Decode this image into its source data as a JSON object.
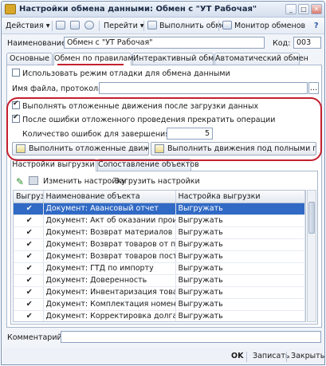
{
  "window": {
    "title": "Настройки обмена данными: Обмен с \"УТ Рабочая\"",
    "btn_min": "_",
    "btn_max": "□",
    "btn_close": "✕"
  },
  "toolbar": {
    "actions": "Действия ▾",
    "goto": "Перейти ▾",
    "run_exchange": "Выполнить обмен",
    "monitor": "Монитор обменов",
    "help": "?"
  },
  "form": {
    "name_label": "Наименование:",
    "name_value": "Обмен с \"УТ Рабочая\"",
    "code_label": "Код:",
    "code_value": "003"
  },
  "tabs": [
    "Основные",
    "Обмен по правилам",
    "Интерактивный обмен",
    "Автоматический обмен"
  ],
  "rules": {
    "debug_mode": "Использовать режим отладки для обмена данными",
    "file_label": "Имя файла, протокола:",
    "file_value": "",
    "deferred_after_load": "Выполнять отложенные движения после загрузки данных",
    "stop_on_error": "После ошибки отложенного проведения прекратить операции",
    "errors_count_label": "Количество ошибок для завершения:",
    "errors_count_value": "5",
    "btn_run_deferred": "Выполнить отложенные движения...",
    "btn_run_full_rights": "Выполнить движения под полными правами..."
  },
  "subtabs": [
    "Настройки выгрузки",
    "Сопоставление объектов"
  ],
  "subtoolbar": {
    "change": "Изменить настройку",
    "load": "Загрузить настройки"
  },
  "table": {
    "columns": [
      "Выгрузк...",
      "Наименование объекта",
      "Настройка выгрузки"
    ],
    "rows": [
      {
        "check": "✔",
        "name": "Документ: Авансовый отчет",
        "setting": "Выгружать",
        "selected": true
      },
      {
        "check": "✔",
        "name": "Документ: Акт об оказании производ...",
        "setting": "Выгружать"
      },
      {
        "check": "✔",
        "name": "Документ: Возврат материалов из эк...",
        "setting": "Выгружать"
      },
      {
        "check": "✔",
        "name": "Документ: Возврат товаров от покуп...",
        "setting": "Выгружать"
      },
      {
        "check": "✔",
        "name": "Документ: Возврат товаров поставщ...",
        "setting": "Выгружать"
      },
      {
        "check": "✔",
        "name": "Документ: ГТД по импорту",
        "setting": "Выгружать"
      },
      {
        "check": "✔",
        "name": "Документ: Доверенность",
        "setting": "Выгружать"
      },
      {
        "check": "✔",
        "name": "Документ: Инвентаризация товаров ...",
        "setting": "Выгружать"
      },
      {
        "check": "✔",
        "name": "Документ: Комплектация номенклат...",
        "setting": "Выгружать"
      },
      {
        "check": "✔",
        "name": "Документ: Корректировка долга",
        "setting": "Выгружать"
      }
    ]
  },
  "comment_label": "Комментарий:",
  "footer": {
    "ok": "OK",
    "save": "Записать",
    "close": "Закрыть"
  }
}
